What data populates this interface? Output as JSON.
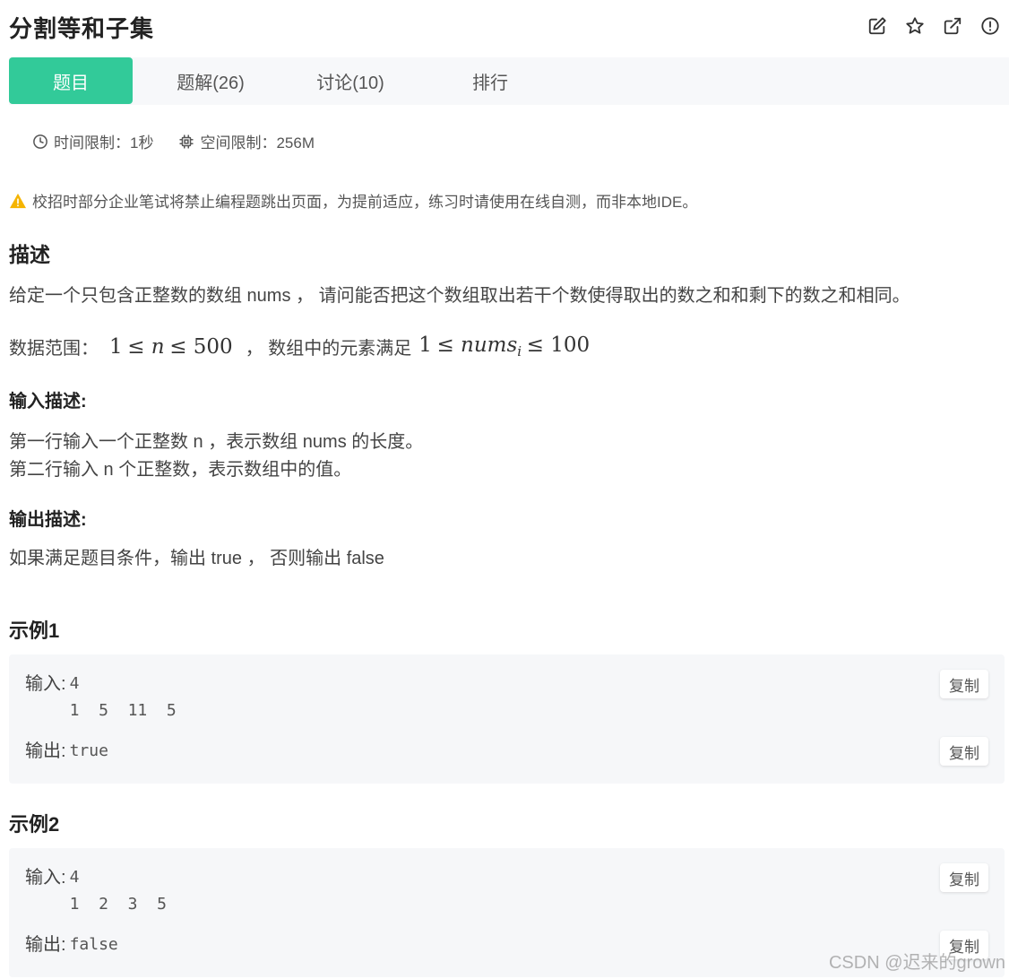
{
  "header": {
    "title": "分割等和子集",
    "icons": [
      "edit-icon",
      "star-icon",
      "external-link-icon",
      "report-icon"
    ]
  },
  "tabs": [
    {
      "label": "题目",
      "active": true
    },
    {
      "label": "题解(26)",
      "active": false
    },
    {
      "label": "讨论(10)",
      "active": false
    },
    {
      "label": "排行",
      "active": false
    }
  ],
  "limits": {
    "time": "时间限制：1秒",
    "space": "空间限制：256M"
  },
  "warning": "校招时部分企业笔试将禁止编程题跳出页面，为提前适应，练习时请使用在线自测，而非本地IDE。",
  "description": {
    "heading": "描述",
    "text": "给定一个只包含正整数的数组 nums ， 请问能否把这个数组取出若干个数使得取出的数之和和剩下的数之和相同。",
    "range_label": "数据范围：",
    "range_sep": "，  数组中的元素满足",
    "range_n": {
      "low": "1",
      "var": "n",
      "high": "500"
    },
    "range_nums": {
      "low": "1",
      "var": "nums",
      "sub": "i",
      "high": "100"
    }
  },
  "input_desc": {
    "heading": "输入描述:",
    "line1": "第一行输入一个正整数 n ，表示数组 nums 的长度。",
    "line2": "第二行输入 n 个正整数，表示数组中的值。"
  },
  "output_desc": {
    "heading": "输出描述:",
    "text": "如果满足题目条件，输出 true ， 否则输出 false"
  },
  "examples": [
    {
      "heading": "示例1",
      "input_label": "输入:",
      "input": "4\n1 5 11 5",
      "output_label": "输出:",
      "output": "true",
      "copy_label": "复制"
    },
    {
      "heading": "示例2",
      "input_label": "输入:",
      "input": "4\n1 2 3 5",
      "output_label": "输出:",
      "output": "false",
      "copy_label": "复制"
    }
  ],
  "watermark": "CSDN @迟来的grown",
  "colors": {
    "accent": "#32ca99",
    "tabbar_bg": "#f7f8fa",
    "example_bg": "#f6f7f9",
    "warning": "#f5b400"
  }
}
